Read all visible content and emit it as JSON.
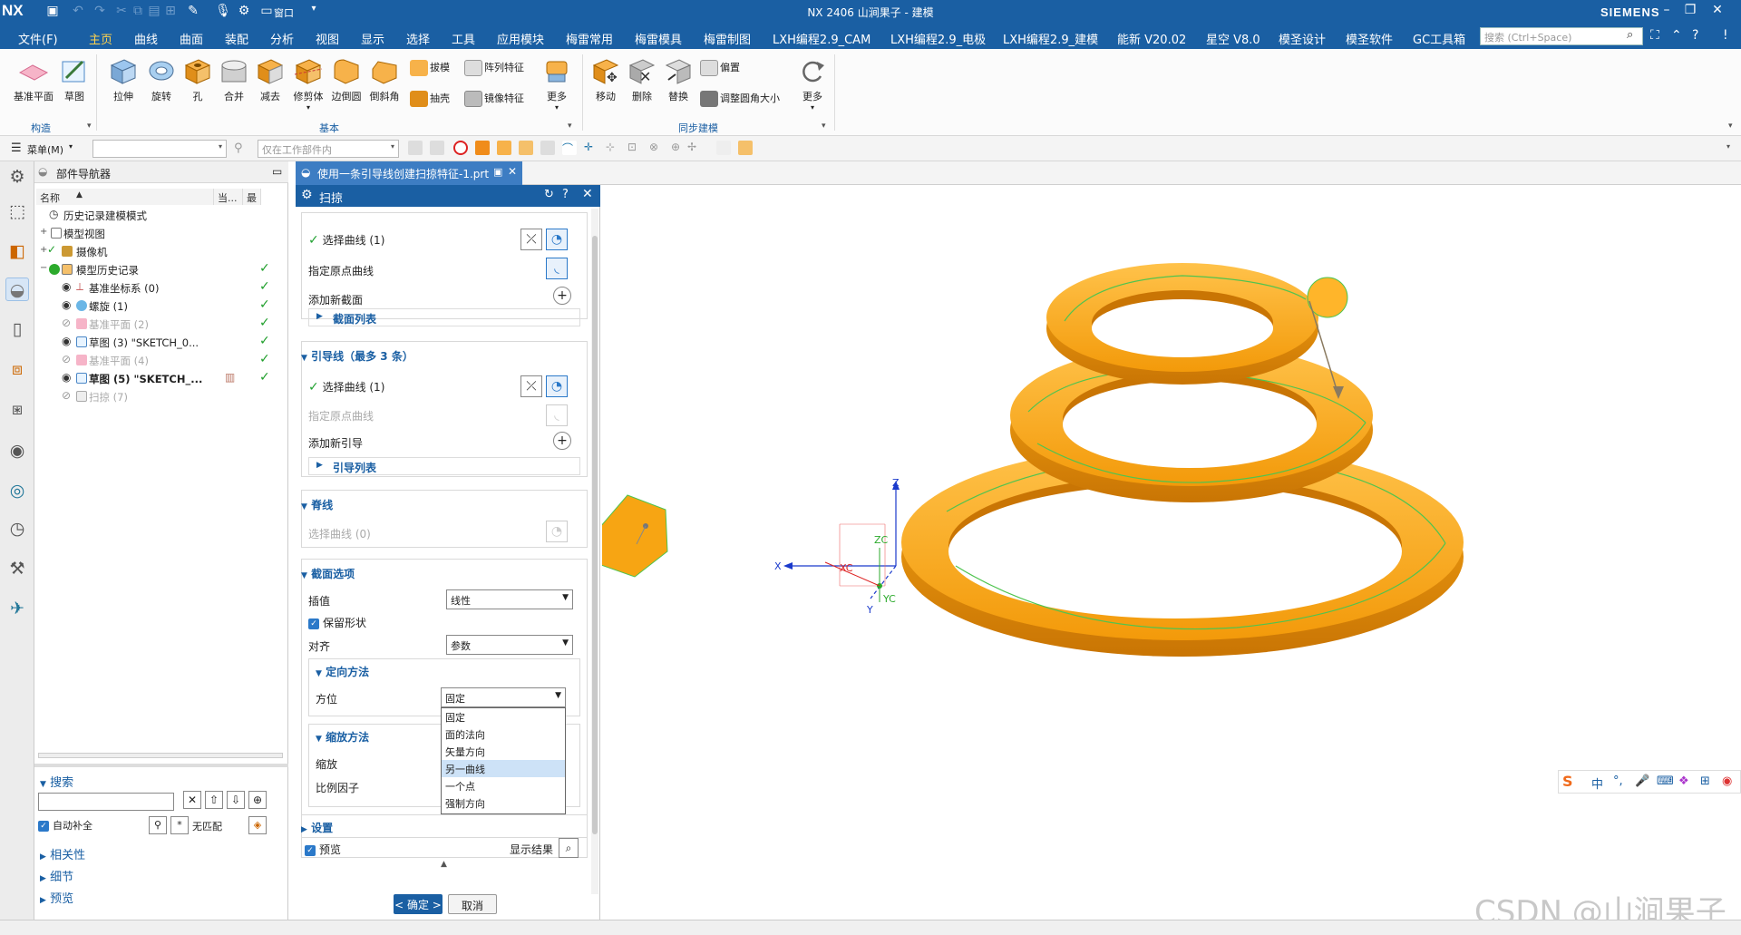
{
  "app": {
    "logo": "NX",
    "window_title": "NX 2406 山涧果子 - 建模",
    "brand": "SIEMENS"
  },
  "menu": {
    "items": [
      "文件(F)",
      "主页",
      "曲线",
      "曲面",
      "装配",
      "分析",
      "视图",
      "显示",
      "选择",
      "工具",
      "应用模块",
      "梅雷常用",
      "梅雷模具",
      "梅雷制图",
      "LXH编程2.9_CAM",
      "LXH编程2.9_电极",
      "LXH编程2.9_建模",
      "能新 V20.02",
      "星空 V8.0",
      "模圣设计",
      "模圣软件",
      "GC工具箱"
    ],
    "active_index": 1,
    "search_placeholder": "搜索 (Ctrl+Space)",
    "quick_window": "窗口"
  },
  "ribbon": {
    "buttons": [
      "基准平面",
      "草图",
      "拉伸",
      "旋转",
      "孔",
      "合并",
      "减去",
      "修剪体",
      "边倒圆",
      "倒斜角",
      "更多",
      "移动",
      "删除",
      "替换",
      "更多"
    ],
    "small": [
      "拔模",
      "阵列特征",
      "抽壳",
      "镜像特征",
      "偏置",
      "调整圆角大小"
    ],
    "groups": [
      "构造",
      "基本",
      "同步建模"
    ]
  },
  "toolbar2": {
    "menu_label": "菜单(M)",
    "filter_placeholder": "仅在工作部件内"
  },
  "navigator": {
    "title": "部件导航器",
    "columns": [
      "名称",
      "当...",
      "最"
    ],
    "rows": [
      {
        "label": "历史记录建模模式",
        "depth": 1,
        "dim": false
      },
      {
        "label": "模型视图",
        "depth": 1,
        "dim": false
      },
      {
        "label": "摄像机",
        "depth": 1,
        "dim": false
      },
      {
        "label": "模型历史记录",
        "depth": 1,
        "dim": false
      },
      {
        "label": "基准坐标系 (0)",
        "depth": 2,
        "dim": false
      },
      {
        "label": "螺旋 (1)",
        "depth": 2,
        "dim": false
      },
      {
        "label": "基准平面 (2)",
        "depth": 2,
        "dim": true
      },
      {
        "label": "草图 (3) \"SKETCH_0...",
        "depth": 2,
        "dim": false
      },
      {
        "label": "基准平面 (4)",
        "depth": 2,
        "dim": true
      },
      {
        "label": "草图 (5) \"SKETCH_...",
        "depth": 2,
        "dim": false,
        "bold": true
      },
      {
        "label": "扫掠 (7)",
        "depth": 2,
        "dim": true
      }
    ],
    "search_label": "搜索",
    "autocomplete_label": "自动补全",
    "no_match_label": "无匹配",
    "related_label": "相关性",
    "detail_label": "细节",
    "preview_label": "预览"
  },
  "tab": {
    "label": "使用一条引导线创建扫掠特征-1.prt"
  },
  "dialog": {
    "title": "扫掠",
    "section_curves_select": "选择曲线 (1)",
    "specify_origin": "指定原点曲线",
    "add_section": "添加新截面",
    "section_list": "截面列表",
    "guides_head": "引导线（最多 3 条）",
    "guides_select": "选择曲线 (1)",
    "guides_origin": "指定原点曲线",
    "add_guide": "添加新引导",
    "guide_list": "引导列表",
    "spine_head": "脊线",
    "spine_select": "选择曲线 (0)",
    "section_options": "截面选项",
    "interp_label": "插值",
    "interp_value": "线性",
    "preserve_shape": "保留形状",
    "align_label": "对齐",
    "align_value": "参数",
    "orient_head": "定向方法",
    "orient_label": "方位",
    "orient_value": "固定",
    "orient_options": [
      "固定",
      "面的法向",
      "矢量方向",
      "另一曲线",
      "一个点",
      "强制方向"
    ],
    "orient_highlight": 3,
    "scale_head": "缩放方法",
    "scale_label": "缩放",
    "scale_factor": "比例因子",
    "settings_head": "设置",
    "preview_label": "预览",
    "show_result": "显示结果",
    "ok": "< 确定 >",
    "cancel": "取消"
  },
  "viewport": {
    "axis_labels": {
      "z": "Z",
      "zc": "ZC",
      "x": "X",
      "xc": "XC",
      "y": "Y",
      "yc": "YC"
    },
    "colors": {
      "spring": "#f4a10e",
      "spring_dark": "#c77a06",
      "spring_light": "#ffbe3a",
      "guide": "#4fc44f"
    }
  },
  "ime": {
    "items": [
      "中",
      "°,",
      "🎤",
      "⌨",
      "👕",
      "⋮⋮"
    ]
  },
  "watermark": "CSDN @山涧果子"
}
